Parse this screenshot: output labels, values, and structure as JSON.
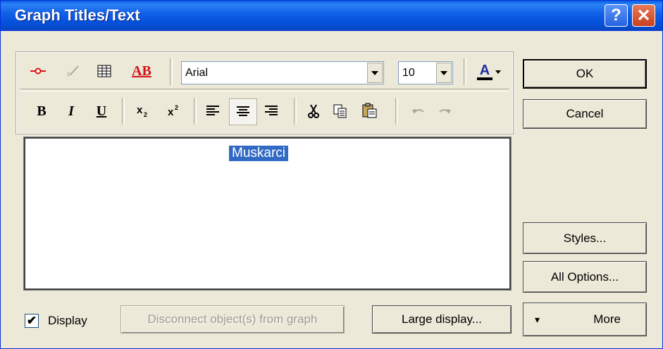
{
  "window": {
    "title": "Graph Titles/Text"
  },
  "titlebar": {
    "help_label": "?",
    "close_label": "✕"
  },
  "toolbar": {
    "font": "Arial",
    "size": "10",
    "bold_label": "B",
    "italic_label": "I",
    "underline_label": "U",
    "ab_label": "AB",
    "font_color_label": "A"
  },
  "editor": {
    "text": "Muskarci"
  },
  "buttons": {
    "ok": "OK",
    "cancel": "Cancel",
    "styles": "Styles...",
    "all_options": "All Options...",
    "more": "More",
    "more_glyph": "▾",
    "large_display": "Large display...",
    "disconnect": "Disconnect object(s) from graph"
  },
  "display_checkbox": {
    "label": "Display",
    "checked": true,
    "mark": "✔"
  }
}
